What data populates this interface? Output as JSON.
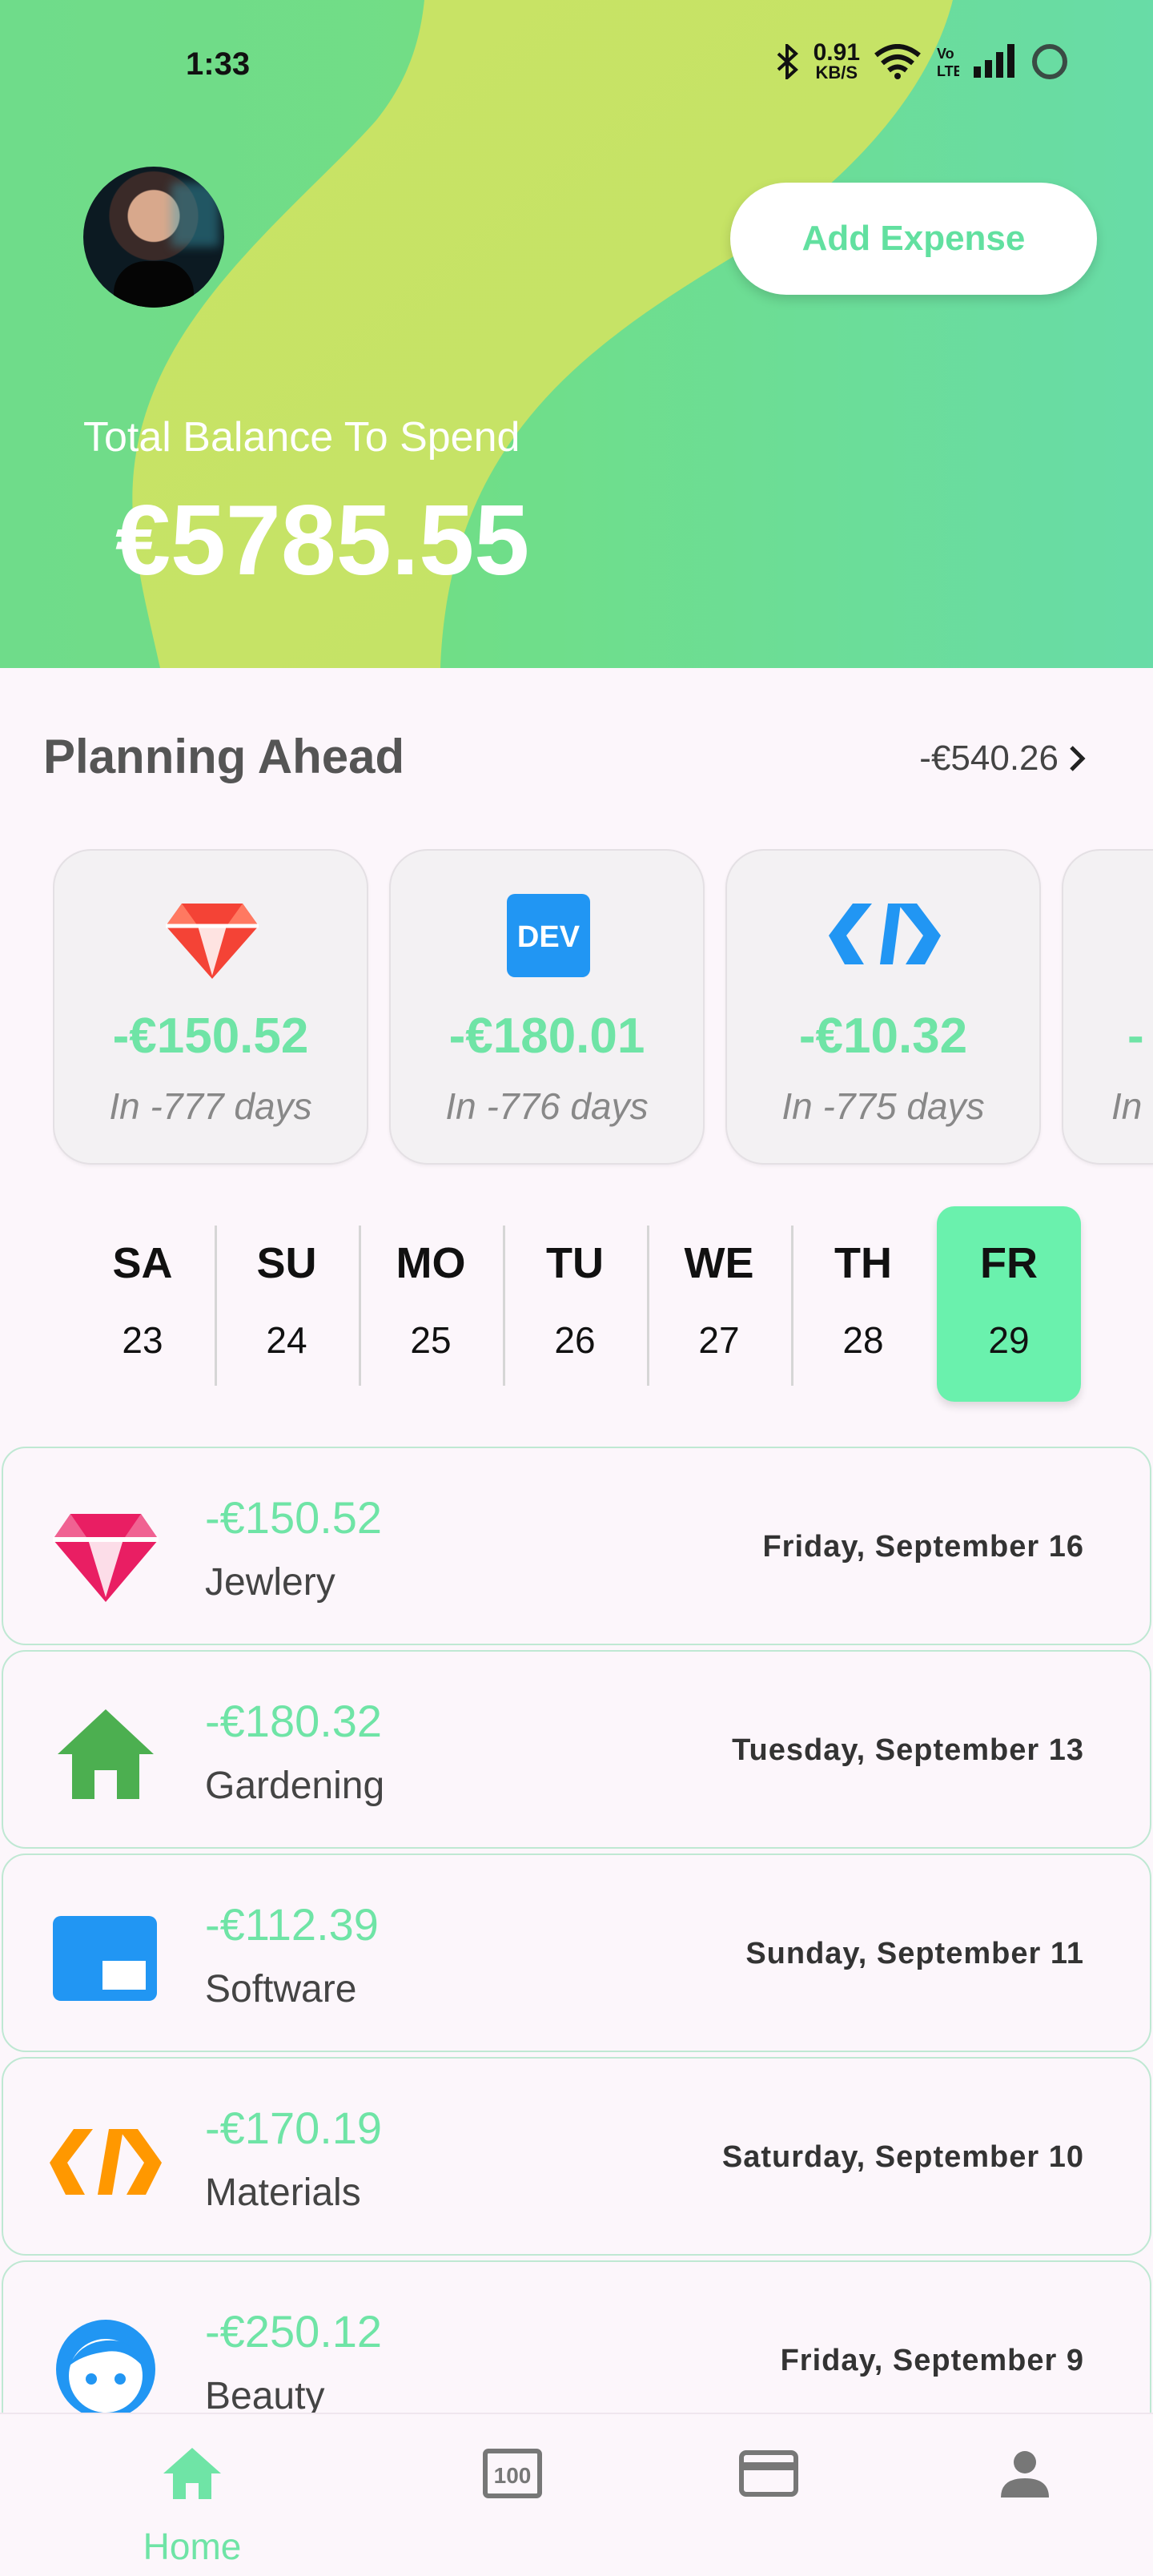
{
  "status_bar": {
    "time": "1:33",
    "net_speed_value": "0.91",
    "net_speed_unit": "KB/S",
    "icons": [
      "bluetooth-icon",
      "wifi-icon",
      "volte-icon",
      "signal-icon",
      "battery-ring-icon"
    ]
  },
  "header": {
    "add_expense_label": "Add Expense",
    "balance_label": "Total Balance To Spend",
    "balance_value": "€5785.55"
  },
  "planning": {
    "title": "Planning Ahead",
    "total": "-€540.26",
    "cards": [
      {
        "icon": "diamond-icon",
        "amount": "-€150.52",
        "days": "In -777 days",
        "color": "#f44336"
      },
      {
        "icon": "dev-logo-icon",
        "amount": "-€180.01",
        "days": "In -776 days",
        "color": "#2196f3"
      },
      {
        "icon": "code-brackets-icon",
        "amount": "-€10.32",
        "days": "In -775 days",
        "color": "#2196f3"
      },
      {
        "icon": "partial-card-icon",
        "amount": "-",
        "days": "In",
        "color": "#6fe4a6"
      }
    ]
  },
  "days": [
    {
      "name": "SA",
      "num": "23"
    },
    {
      "name": "SU",
      "num": "24"
    },
    {
      "name": "MO",
      "num": "25"
    },
    {
      "name": "TU",
      "num": "26"
    },
    {
      "name": "WE",
      "num": "27"
    },
    {
      "name": "TH",
      "num": "28"
    },
    {
      "name": "FR",
      "num": "29",
      "selected": true
    }
  ],
  "transactions": [
    {
      "icon": "diamond-icon",
      "amount": "-€150.52",
      "category": "Jewlery",
      "date": "Friday, September 16",
      "color": "#e91e63"
    },
    {
      "icon": "house-icon",
      "amount": "-€180.32",
      "category": "Gardening",
      "date": "Tuesday, September 13",
      "color": "#4caf50"
    },
    {
      "icon": "window-icon",
      "amount": "-€112.39",
      "category": "Software",
      "date": "Sunday, September 11",
      "color": "#2196f3"
    },
    {
      "icon": "code-brackets-icon",
      "amount": "-€170.19",
      "category": "Materials",
      "date": "Saturday, September 10",
      "color": "#ff9800"
    },
    {
      "icon": "face-icon",
      "amount": "-€250.12",
      "category": "Beauty",
      "date": "Friday, September 9",
      "color": "#2196f3"
    }
  ],
  "bottom_nav": {
    "home_label": "Home",
    "items": [
      "home-icon",
      "calendar-100-icon",
      "credit-card-icon",
      "person-icon"
    ]
  },
  "colors": {
    "accent": "#6fe4a6",
    "header_green": "#72dd86",
    "header_lime": "#c8e365",
    "header_teal": "#66dbb7",
    "selected_day": "#6af1ad"
  }
}
